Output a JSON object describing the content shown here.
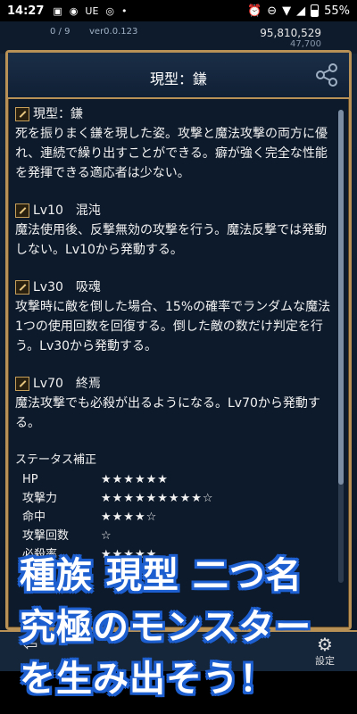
{
  "status_bar": {
    "time": "14:27",
    "carrier": "UE",
    "battery": "55%"
  },
  "hud": {
    "count": "0 / 9",
    "version": "ver0.0.123",
    "coins": "95,810,529",
    "sub": "47,700"
  },
  "modal": {
    "title": "現型：鎌",
    "sections": [
      {
        "title": "現型：鎌",
        "body": "死を振りまく鎌を現した姿。攻撃と魔法攻撃の両方に優れ、連続で繰り出すことができる。癖が強く完全な性能を発揮できる適応者は少ない。"
      },
      {
        "title": "Lv10　混沌",
        "body": "魔法使用後、反撃無効の攻撃を行う。魔法反撃では発動しない。Lv10から発動する。"
      },
      {
        "title": "Lv30　吸魂",
        "body": "攻撃時に敵を倒した場合、15%の確率でランダムな魔法1つの使用回数を回復する。倒した敵の数だけ判定を行う。Lv30から発動する。"
      },
      {
        "title": "Lv70　終焉",
        "body": "魔法攻撃でも必殺が出るようになる。Lv70から発動する。"
      }
    ],
    "status_heading": "ステータス補正",
    "status_rows": [
      {
        "key": "HP",
        "stars": "★★★★★★"
      },
      {
        "key": "攻撃力",
        "stars": "★★★★★★★★★☆"
      },
      {
        "key": "命中",
        "stars": "★★★★☆"
      },
      {
        "key": "攻撃回数",
        "stars": "☆"
      },
      {
        "key": "必殺率",
        "stars": "★★★★★"
      }
    ]
  },
  "bottom_nav": {
    "settings_label": "設定"
  },
  "promo": {
    "line1": "種族 現型 二つ名",
    "line2": "究極のモンスター",
    "line3": "を生み出そう！"
  }
}
